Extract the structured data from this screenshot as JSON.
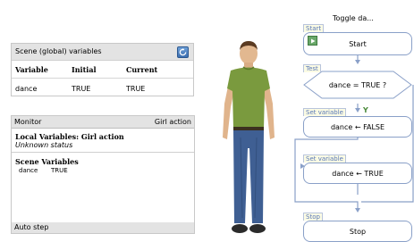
{
  "scene": {
    "title": "Scene (global) variables",
    "refresh_icon": "refresh-icon",
    "columns": [
      "Variable",
      "Initial",
      "Current"
    ],
    "rows": [
      {
        "variable": "dance",
        "initial": "TRUE",
        "current": "TRUE"
      }
    ]
  },
  "monitor": {
    "title": "Monitor",
    "agent": "Girl action",
    "local_title": "Local Variables: Girl action",
    "local_status": "Unknown status",
    "scene_vars_title": "Scene Variables",
    "scene_vars": [
      {
        "name": "dance",
        "value": "TRUE"
      }
    ],
    "auto_step": "Auto step"
  },
  "flow": {
    "title": "Toggle da...",
    "start_label": "Start",
    "start_text": "Start",
    "test_label": "Test",
    "test_text": "dance  = TRUE  ?",
    "set1_label": "Set variable",
    "set1_text": "dance  ← FALSE",
    "yes_text": "Y",
    "set2_label": "Set variable",
    "set2_text": "dance  ← TRUE",
    "stop_label": "Stop",
    "stop_text": "Stop"
  },
  "colors": {
    "panel_header": "#e3e3e3",
    "node_border": "#8aa0c8",
    "label_text": "#5a78b8",
    "play_green": "#6aa86a"
  }
}
